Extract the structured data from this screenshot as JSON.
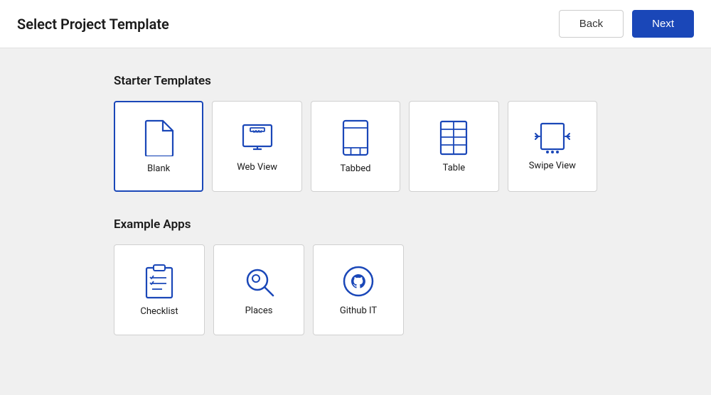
{
  "header": {
    "title": "Select Project Template",
    "back_label": "Back",
    "next_label": "Next"
  },
  "starter_templates": {
    "section_title": "Starter Templates",
    "items": [
      {
        "id": "blank",
        "label": "Blank",
        "selected": true
      },
      {
        "id": "web-view",
        "label": "Web View",
        "selected": false
      },
      {
        "id": "tabbed",
        "label": "Tabbed",
        "selected": false
      },
      {
        "id": "table",
        "label": "Table",
        "selected": false
      },
      {
        "id": "swipe-view",
        "label": "Swipe View",
        "selected": false
      }
    ]
  },
  "example_apps": {
    "section_title": "Example Apps",
    "items": [
      {
        "id": "checklist",
        "label": "Checklist"
      },
      {
        "id": "places",
        "label": "Places"
      },
      {
        "id": "github-it",
        "label": "Github IT"
      }
    ]
  }
}
